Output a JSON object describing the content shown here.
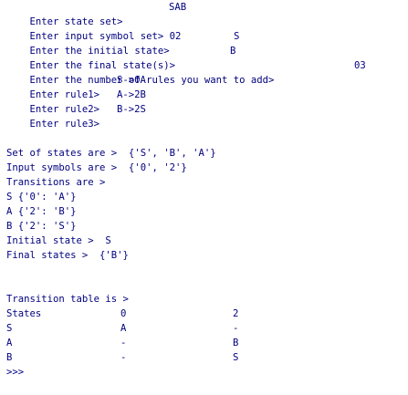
{
  "input_section": [
    {
      "label": "Enter state set>",
      "value": "SAB"
    },
    {
      "label": "Enter input symbol set>",
      "value": "02"
    },
    {
      "label": "Enter the initial state>",
      "value": "S"
    },
    {
      "label": "Enter the final state(s)>",
      "value": "B"
    },
    {
      "label": "Enter the number of rules you want to add>",
      "value": "03"
    },
    {
      "label": "Enter rule1>",
      "value": "S->0A"
    },
    {
      "label": "Enter rule2>",
      "value": "A->2B"
    },
    {
      "label": "Enter rule3>",
      "value": "B->2S"
    }
  ],
  "summary_section": {
    "states_line": "Set of states are >  {'S', 'B', 'A'}",
    "symbols_line": "Input symbols are >  {'0', '2'}",
    "transitions_header": "Transitions are >",
    "transitions": [
      "S {'0': 'A'}",
      "A {'2': 'B'}",
      "B {'2': 'S'}"
    ],
    "initial_line": "Initial state >  S",
    "final_line": "Final states >  {'B'}"
  },
  "table_section": {
    "header": "Transition table is >",
    "columns": [
      "States",
      "0",
      "2"
    ],
    "rows": [
      [
        "S",
        "A",
        "-"
      ],
      [
        "A",
        "-",
        "B"
      ],
      [
        "B",
        "-",
        "S"
      ]
    ]
  },
  "prompt": ">>>",
  "colors": {
    "text": "#00007f",
    "background": "#ffffff"
  }
}
